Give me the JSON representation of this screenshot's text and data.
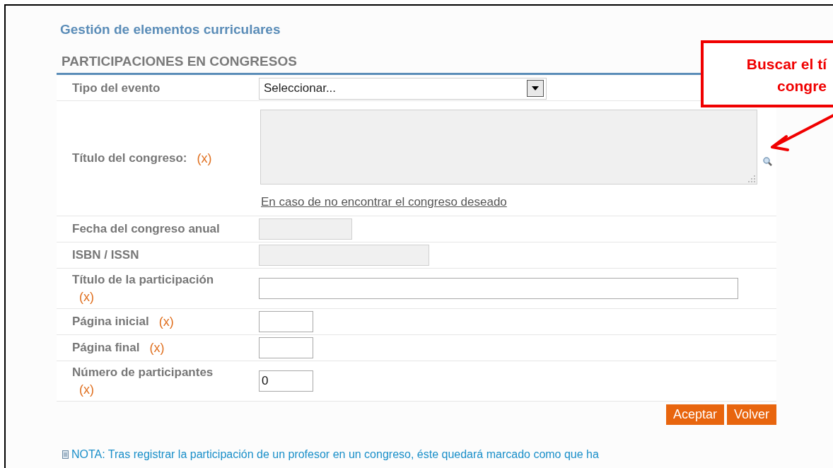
{
  "breadcrumb": "Gestión de elementos curriculares",
  "section_title": "PARTICIPACIONES EN CONGRESOS",
  "fields": [
    {
      "kind": "select",
      "label": "Tipo del evento",
      "value": "Seleccionar..."
    },
    {
      "kind": "search_textarea",
      "label": "Título del congreso:",
      "required_mark": "(x)",
      "disabled": true,
      "link": "En caso de no encontrar el congreso deseado"
    },
    {
      "kind": "text",
      "label": "Fecha del congreso anual",
      "disabled": true
    },
    {
      "kind": "text",
      "label": "ISBN / ISSN",
      "disabled": true
    },
    {
      "kind": "text",
      "label": "Título de la participación",
      "required_mark": "(x)",
      "disabled": false
    },
    {
      "kind": "text",
      "label": "Página inicial",
      "required_mark": "(x)",
      "disabled": false
    },
    {
      "kind": "text",
      "label": "Página final",
      "required_mark": "(x)",
      "disabled": false
    },
    {
      "kind": "text",
      "label": "Número de participantes",
      "required_mark": "(x)",
      "disabled": false,
      "value": "0"
    }
  ],
  "buttons": [
    "Aceptar",
    "Volver"
  ],
  "note": "NOTA: Tras registrar la participación de un profesor en un congreso, éste quedará marcado como que ha",
  "callout": {
    "lines": [
      "Buscar el tí",
      "congre"
    ]
  }
}
